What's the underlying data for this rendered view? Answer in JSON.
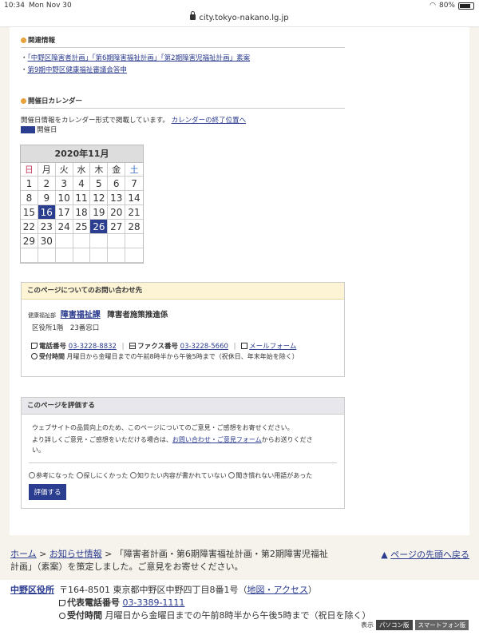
{
  "status": {
    "time": "10:34",
    "date": "Mon Nov 30",
    "battery": "80%"
  },
  "browser": {
    "url": "city.tokyo-nakano.lg.jp"
  },
  "related": {
    "heading": "関連情報",
    "links": [
      "「中野区障害者計画」「第6期障害福祉計画」「第2期障害児福祉計画」素案",
      "第9期中野区健康福祉審議会答申"
    ]
  },
  "calendar_section": {
    "heading": "開催日カレンダー",
    "description": "開催日情報をカレンダー形式で掲載しています。",
    "end_link": "カレンダーの終了位置へ",
    "legend": "開催日",
    "title": "2020年11月",
    "weekdays": [
      "日",
      "月",
      "火",
      "水",
      "木",
      "金",
      "土"
    ],
    "weeks": [
      [
        "1",
        "2",
        "3",
        "4",
        "5",
        "6",
        "7"
      ],
      [
        "8",
        "9",
        "10",
        "11",
        "12",
        "13",
        "14"
      ],
      [
        "15",
        "16",
        "17",
        "18",
        "19",
        "20",
        "21"
      ],
      [
        "22",
        "23",
        "24",
        "25",
        "26",
        "27",
        "28"
      ],
      [
        "29",
        "30",
        "",
        "",
        "",
        "",
        ""
      ],
      [
        "",
        "",
        "",
        "",
        "",
        "",
        ""
      ]
    ],
    "open_days": [
      "16",
      "26"
    ]
  },
  "contact": {
    "heading": "このページについてのお問い合わせ先",
    "dept_label": "健康福祉部",
    "dept_link": "障害福祉課",
    "section": "障害者施策推進係",
    "location": "区役所1階　23番窓口",
    "tel_label": "電話番号",
    "tel": "03-3228-8832",
    "fax_label": "ファクス番号",
    "fax": "03-3228-5660",
    "mail_link": "メールフォーム",
    "hours_label": "受付時間",
    "hours": "月曜日から金曜日までの午前8時半から午後5時まで（祝休日、年末年始を除く）"
  },
  "rating": {
    "heading": "このページを評価する",
    "text1": "ウェブサイトの品質向上のため、このページについてのご意見・ご感想をお寄せください。",
    "text2a": "より詳しくご意見・ご感想をいただける場合は、",
    "text2link": "お問い合わせ・ご意見フォーム",
    "text2b": "からお送りくださ",
    "text2c": "い。",
    "options": [
      "参考になった",
      "探しにくかった",
      "知りたい内容が書かれていない",
      "聞き慣れない用語があった"
    ],
    "button": "評価する"
  },
  "breadcrumb": {
    "home": "ホーム",
    "news": "お知らせ情報",
    "current1": "「障害者計画・第6期障害福祉計画・第2期障害児福祉",
    "current2": "計画」（素案）を策定しました。ご意見をお寄せください。",
    "top_link": "ページの先頭へ戻る"
  },
  "footer": {
    "name": "中野区役所",
    "address": "〒164-8501 東京都中野区中野四丁目8番1号（",
    "map_link": "地図・アクセス",
    "address_end": "）",
    "tel_label": "代表電話番号",
    "tel": "03-3389-1111",
    "hours_label": "受付時間",
    "hours": "月曜日から金曜日までの午前8時半から午後5時まで（祝日を除く）",
    "display_label": "表示",
    "pc": "パソコン版",
    "sp": "スマートフォン版"
  }
}
